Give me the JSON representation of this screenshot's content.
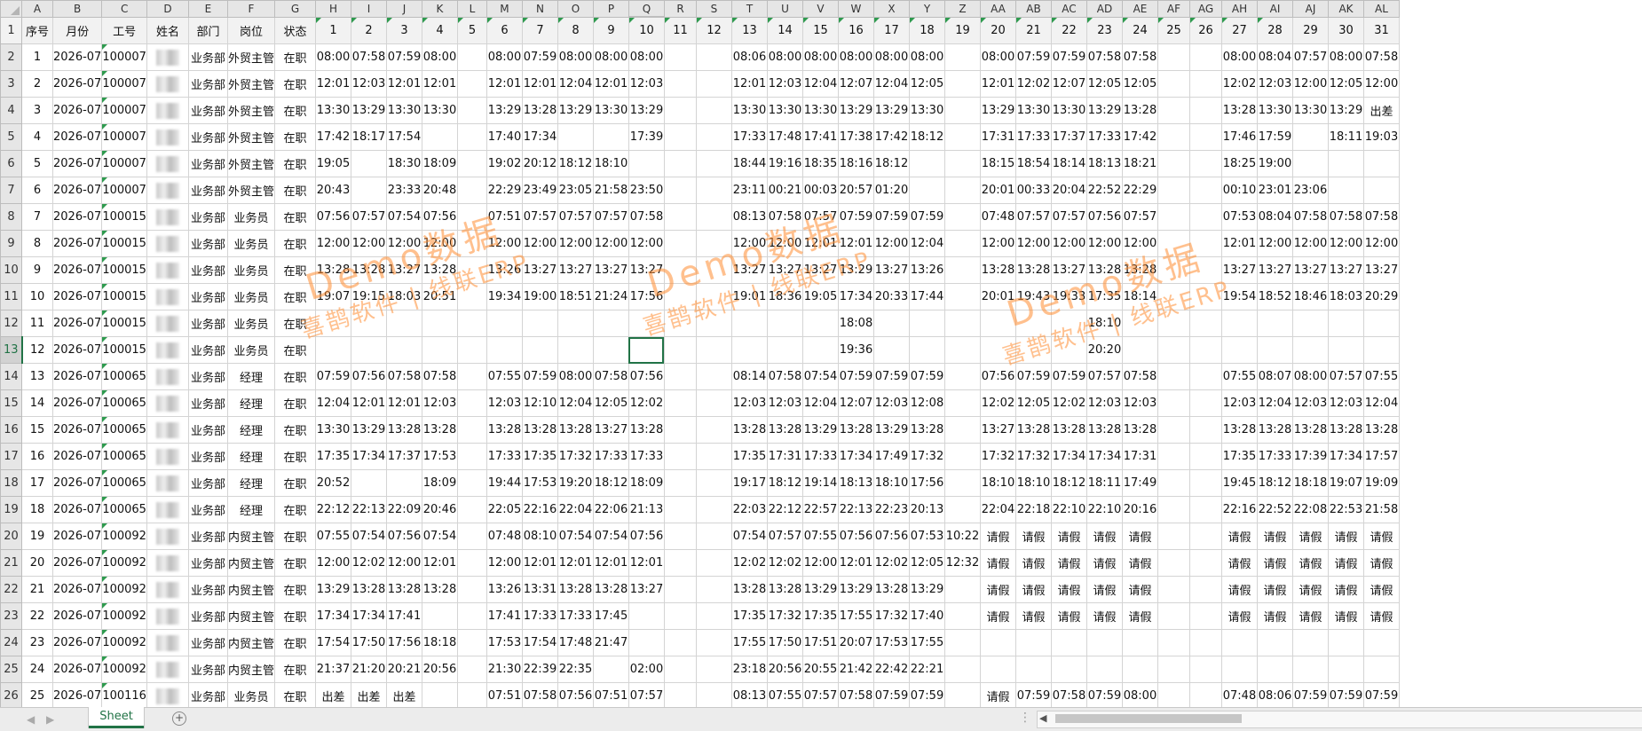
{
  "columns": [
    "A",
    "B",
    "C",
    "D",
    "E",
    "F",
    "G",
    "H",
    "I",
    "J",
    "K",
    "L",
    "M",
    "N",
    "O",
    "P",
    "Q",
    "R",
    "S",
    "T",
    "U",
    "V",
    "W",
    "X",
    "Y",
    "Z",
    "AA",
    "AB",
    "AC",
    "AD",
    "AE",
    "AF",
    "AG",
    "AH",
    "AI",
    "AJ",
    "AK",
    "AL"
  ],
  "selected_column": "Q",
  "selected_row": "13",
  "row_numbers": [
    "1",
    "2",
    "3",
    "4",
    "5",
    "6",
    "7",
    "8",
    "9",
    "10",
    "11",
    "12",
    "13",
    "14",
    "15",
    "16",
    "17",
    "18",
    "19",
    "20",
    "21",
    "22",
    "23",
    "24",
    "25",
    "26"
  ],
  "header_row": [
    "序号",
    "月份",
    "工号",
    "姓名",
    "部门",
    "岗位",
    "状态",
    "1",
    "2",
    "3",
    "4",
    "5",
    "6",
    "7",
    "8",
    "9",
    "10",
    "11",
    "12",
    "13",
    "14",
    "15",
    "16",
    "17",
    "18",
    "19",
    "20",
    "21",
    "22",
    "23",
    "24",
    "25",
    "26",
    "27",
    "28",
    "29",
    "30",
    "31"
  ],
  "rows": [
    [
      "1",
      "2026-07",
      "100007",
      "",
      "业务部",
      "外贸主管",
      "在职",
      "08:00",
      "07:58",
      "07:59",
      "08:00",
      "",
      "08:00",
      "07:59",
      "08:00",
      "08:00",
      "08:00",
      "",
      "",
      "08:06",
      "08:00",
      "08:00",
      "08:00",
      "08:00",
      "08:00",
      "",
      "08:00",
      "07:59",
      "07:59",
      "07:58",
      "07:58",
      "",
      "",
      "08:00",
      "08:04",
      "07:57",
      "08:00",
      "07:58"
    ],
    [
      "2",
      "2026-07",
      "100007",
      "",
      "业务部",
      "外贸主管",
      "在职",
      "12:01",
      "12:03",
      "12:01",
      "12:01",
      "",
      "12:01",
      "12:01",
      "12:04",
      "12:01",
      "12:03",
      "",
      "",
      "12:01",
      "12:03",
      "12:04",
      "12:07",
      "12:04",
      "12:05",
      "",
      "12:01",
      "12:02",
      "12:07",
      "12:05",
      "12:05",
      "",
      "",
      "12:02",
      "12:03",
      "12:00",
      "12:05",
      "12:00"
    ],
    [
      "3",
      "2026-07",
      "100007",
      "",
      "业务部",
      "外贸主管",
      "在职",
      "13:30",
      "13:29",
      "13:30",
      "13:30",
      "",
      "13:29",
      "13:28",
      "13:29",
      "13:30",
      "13:29",
      "",
      "",
      "13:30",
      "13:30",
      "13:30",
      "13:29",
      "13:29",
      "13:30",
      "",
      "13:29",
      "13:30",
      "13:30",
      "13:29",
      "13:28",
      "",
      "",
      "13:28",
      "13:30",
      "13:30",
      "13:29",
      "出差"
    ],
    [
      "4",
      "2026-07",
      "100007",
      "",
      "业务部",
      "外贸主管",
      "在职",
      "17:42",
      "18:17",
      "17:54",
      "",
      "",
      "17:40",
      "17:34",
      "",
      "",
      "17:39",
      "",
      "",
      "17:33",
      "17:48",
      "17:41",
      "17:38",
      "17:42",
      "18:12",
      "",
      "17:31",
      "17:33",
      "17:37",
      "17:33",
      "17:42",
      "",
      "",
      "17:46",
      "17:59",
      "",
      "18:11",
      "19:03"
    ],
    [
      "5",
      "2026-07",
      "100007",
      "",
      "业务部",
      "外贸主管",
      "在职",
      "19:05",
      "",
      "18:30",
      "18:09",
      "",
      "19:02",
      "20:12",
      "18:12",
      "18:10",
      "",
      "",
      "",
      "18:44",
      "19:16",
      "18:35",
      "18:16",
      "18:12",
      "",
      "",
      "18:15",
      "18:54",
      "18:14",
      "18:13",
      "18:21",
      "",
      "",
      "18:25",
      "19:00",
      "",
      "",
      ""
    ],
    [
      "6",
      "2026-07",
      "100007",
      "",
      "业务部",
      "外贸主管",
      "在职",
      "20:43",
      "",
      "23:33",
      "20:48",
      "",
      "22:29",
      "23:49",
      "23:05",
      "21:58",
      "23:50",
      "",
      "",
      "23:11",
      "00:21",
      "00:03",
      "20:57",
      "01:20",
      "",
      "",
      "20:01",
      "00:33",
      "20:04",
      "22:52",
      "22:29",
      "",
      "",
      "00:10",
      "23:01",
      "23:06",
      "",
      ""
    ],
    [
      "7",
      "2026-07",
      "100015",
      "",
      "业务部",
      "业务员",
      "在职",
      "07:56",
      "07:57",
      "07:54",
      "07:56",
      "",
      "07:51",
      "07:57",
      "07:57",
      "07:57",
      "07:58",
      "",
      "",
      "08:13",
      "07:58",
      "07:57",
      "07:59",
      "07:59",
      "07:59",
      "",
      "07:48",
      "07:57",
      "07:57",
      "07:56",
      "07:57",
      "",
      "",
      "07:53",
      "08:04",
      "07:58",
      "07:58",
      "07:58"
    ],
    [
      "8",
      "2026-07",
      "100015",
      "",
      "业务部",
      "业务员",
      "在职",
      "12:00",
      "12:00",
      "12:00",
      "12:00",
      "",
      "12:00",
      "12:00",
      "12:00",
      "12:00",
      "12:00",
      "",
      "",
      "12:00",
      "12:00",
      "12:01",
      "12:01",
      "12:00",
      "12:04",
      "",
      "12:00",
      "12:00",
      "12:00",
      "12:00",
      "12:00",
      "",
      "",
      "12:01",
      "12:00",
      "12:00",
      "12:00",
      "12:00"
    ],
    [
      "9",
      "2026-07",
      "100015",
      "",
      "业务部",
      "业务员",
      "在职",
      "13:28",
      "13:28",
      "13:27",
      "13:28",
      "",
      "13:26",
      "13:27",
      "13:27",
      "13:27",
      "13:27",
      "",
      "",
      "13:27",
      "13:27",
      "13:27",
      "13:29",
      "13:27",
      "13:26",
      "",
      "13:28",
      "13:28",
      "13:27",
      "13:28",
      "13:28",
      "",
      "",
      "13:27",
      "13:27",
      "13:27",
      "13:27",
      "13:27"
    ],
    [
      "10",
      "2026-07",
      "100015",
      "",
      "业务部",
      "业务员",
      "在职",
      "19:07",
      "19:15",
      "18:03",
      "20:51",
      "",
      "19:34",
      "19:00",
      "18:51",
      "21:24",
      "17:56",
      "",
      "",
      "19:01",
      "18:36",
      "19:05",
      "17:34",
      "20:33",
      "17:44",
      "",
      "20:01",
      "19:43",
      "19:33",
      "17:35",
      "18:14",
      "",
      "",
      "19:54",
      "18:52",
      "18:46",
      "18:03",
      "20:29"
    ],
    [
      "11",
      "2026-07",
      "100015",
      "",
      "业务部",
      "业务员",
      "在职",
      "",
      "",
      "",
      "",
      "",
      "",
      "",
      "",
      "",
      "",
      "",
      "",
      "",
      "",
      "",
      "18:08",
      "",
      "",
      "",
      "",
      "",
      "",
      "18:10",
      "",
      "",
      "",
      "",
      "",
      "",
      "",
      ""
    ],
    [
      "12",
      "2026-07",
      "100015",
      "",
      "业务部",
      "业务员",
      "在职",
      "",
      "",
      "",
      "",
      "",
      "",
      "",
      "",
      "",
      "",
      "",
      "",
      "",
      "",
      "",
      "19:36",
      "",
      "",
      "",
      "",
      "",
      "",
      "20:20",
      "",
      "",
      "",
      "",
      "",
      "",
      "",
      ""
    ],
    [
      "13",
      "2026-07",
      "100065",
      "",
      "业务部",
      "经理",
      "在职",
      "07:59",
      "07:56",
      "07:58",
      "07:58",
      "",
      "07:55",
      "07:59",
      "08:00",
      "07:58",
      "07:56",
      "",
      "",
      "08:14",
      "07:58",
      "07:54",
      "07:59",
      "07:59",
      "07:59",
      "",
      "07:56",
      "07:59",
      "07:59",
      "07:57",
      "07:58",
      "",
      "",
      "07:55",
      "08:07",
      "08:00",
      "07:57",
      "07:55"
    ],
    [
      "14",
      "2026-07",
      "100065",
      "",
      "业务部",
      "经理",
      "在职",
      "12:04",
      "12:01",
      "12:01",
      "12:03",
      "",
      "12:03",
      "12:10",
      "12:04",
      "12:05",
      "12:02",
      "",
      "",
      "12:03",
      "12:03",
      "12:04",
      "12:07",
      "12:03",
      "12:08",
      "",
      "12:02",
      "12:05",
      "12:02",
      "12:03",
      "12:03",
      "",
      "",
      "12:03",
      "12:04",
      "12:03",
      "12:03",
      "12:04"
    ],
    [
      "15",
      "2026-07",
      "100065",
      "",
      "业务部",
      "经理",
      "在职",
      "13:30",
      "13:29",
      "13:28",
      "13:28",
      "",
      "13:28",
      "13:28",
      "13:28",
      "13:27",
      "13:28",
      "",
      "",
      "13:28",
      "13:28",
      "13:29",
      "13:28",
      "13:29",
      "13:28",
      "",
      "13:27",
      "13:28",
      "13:28",
      "13:28",
      "13:28",
      "",
      "",
      "13:28",
      "13:28",
      "13:28",
      "13:28",
      "13:28"
    ],
    [
      "16",
      "2026-07",
      "100065",
      "",
      "业务部",
      "经理",
      "在职",
      "17:35",
      "17:34",
      "17:37",
      "17:53",
      "",
      "17:33",
      "17:35",
      "17:32",
      "17:33",
      "17:33",
      "",
      "",
      "17:35",
      "17:31",
      "17:33",
      "17:34",
      "17:49",
      "17:32",
      "",
      "17:32",
      "17:32",
      "17:34",
      "17:34",
      "17:31",
      "",
      "",
      "17:35",
      "17:33",
      "17:39",
      "17:34",
      "17:57"
    ],
    [
      "17",
      "2026-07",
      "100065",
      "",
      "业务部",
      "经理",
      "在职",
      "20:52",
      "",
      "",
      "18:09",
      "",
      "19:44",
      "17:53",
      "19:20",
      "18:12",
      "18:09",
      "",
      "",
      "19:17",
      "18:12",
      "19:14",
      "18:13",
      "18:10",
      "17:56",
      "",
      "18:10",
      "18:10",
      "18:12",
      "18:11",
      "17:49",
      "",
      "",
      "19:45",
      "18:12",
      "18:18",
      "19:07",
      "19:09"
    ],
    [
      "18",
      "2026-07",
      "100065",
      "",
      "业务部",
      "经理",
      "在职",
      "22:12",
      "22:13",
      "22:09",
      "20:46",
      "",
      "22:05",
      "22:16",
      "22:04",
      "22:06",
      "21:13",
      "",
      "",
      "22:03",
      "22:12",
      "22:57",
      "22:13",
      "22:23",
      "20:13",
      "",
      "22:04",
      "22:18",
      "22:10",
      "22:10",
      "20:16",
      "",
      "",
      "22:16",
      "22:52",
      "22:08",
      "22:53",
      "21:58"
    ],
    [
      "19",
      "2026-07",
      "100092",
      "",
      "业务部",
      "内贸主管",
      "在职",
      "07:55",
      "07:54",
      "07:56",
      "07:54",
      "",
      "07:48",
      "08:10",
      "07:54",
      "07:54",
      "07:56",
      "",
      "",
      "07:54",
      "07:57",
      "07:55",
      "07:56",
      "07:56",
      "07:53",
      "10:22",
      "请假",
      "请假",
      "请假",
      "请假",
      "请假",
      "",
      "",
      "请假",
      "请假",
      "请假",
      "请假",
      "请假"
    ],
    [
      "20",
      "2026-07",
      "100092",
      "",
      "业务部",
      "内贸主管",
      "在职",
      "12:00",
      "12:02",
      "12:00",
      "12:01",
      "",
      "12:00",
      "12:01",
      "12:01",
      "12:01",
      "12:01",
      "",
      "",
      "12:02",
      "12:02",
      "12:00",
      "12:01",
      "12:02",
      "12:05",
      "12:32",
      "请假",
      "请假",
      "请假",
      "请假",
      "请假",
      "",
      "",
      "请假",
      "请假",
      "请假",
      "请假",
      "请假"
    ],
    [
      "21",
      "2026-07",
      "100092",
      "",
      "业务部",
      "内贸主管",
      "在职",
      "13:29",
      "13:28",
      "13:28",
      "13:28",
      "",
      "13:26",
      "13:31",
      "13:28",
      "13:28",
      "13:27",
      "",
      "",
      "13:28",
      "13:28",
      "13:29",
      "13:29",
      "13:28",
      "13:29",
      "",
      "请假",
      "请假",
      "请假",
      "请假",
      "请假",
      "",
      "",
      "请假",
      "请假",
      "请假",
      "请假",
      "请假"
    ],
    [
      "22",
      "2026-07",
      "100092",
      "",
      "业务部",
      "内贸主管",
      "在职",
      "17:34",
      "17:34",
      "17:41",
      "",
      "",
      "17:41",
      "17:33",
      "17:33",
      "17:45",
      "",
      "",
      "",
      "17:35",
      "17:32",
      "17:35",
      "17:55",
      "17:32",
      "17:40",
      "",
      "请假",
      "请假",
      "请假",
      "请假",
      "请假",
      "",
      "",
      "请假",
      "请假",
      "请假",
      "请假",
      "请假"
    ],
    [
      "23",
      "2026-07",
      "100092",
      "",
      "业务部",
      "内贸主管",
      "在职",
      "17:54",
      "17:50",
      "17:56",
      "18:18",
      "",
      "17:53",
      "17:54",
      "17:48",
      "21:47",
      "",
      "",
      "",
      "17:55",
      "17:50",
      "17:51",
      "20:07",
      "17:53",
      "17:55",
      "",
      "",
      "",
      "",
      "",
      "",
      "",
      "",
      "",
      "",
      "",
      "",
      ""
    ],
    [
      "24",
      "2026-07",
      "100092",
      "",
      "业务部",
      "内贸主管",
      "在职",
      "21:37",
      "21:20",
      "20:21",
      "20:56",
      "",
      "21:30",
      "22:39",
      "22:35",
      "",
      "02:00",
      "",
      "",
      "23:18",
      "20:56",
      "20:55",
      "21:42",
      "22:42",
      "22:21",
      "",
      "",
      "",
      "",
      "",
      "",
      "",
      "",
      "",
      "",
      "",
      "",
      ""
    ],
    [
      "25",
      "2026-07",
      "100116",
      "",
      "业务部",
      "业务员",
      "在职",
      "出差",
      "出差",
      "出差",
      "",
      "",
      "07:51",
      "07:58",
      "07:56",
      "07:51",
      "07:57",
      "",
      "",
      "08:13",
      "07:55",
      "07:57",
      "07:58",
      "07:59",
      "07:59",
      "",
      "请假",
      "07:59",
      "07:58",
      "07:59",
      "08:00",
      "",
      "",
      "07:48",
      "08:06",
      "07:59",
      "07:59",
      "07:59"
    ]
  ],
  "watermarks": [
    {
      "line1": "Demo数据",
      "line2": "喜鹊软件 | 线联ERP"
    },
    {
      "line1": "Demo数据",
      "line2": "喜鹊软件 | 线联ERP"
    },
    {
      "line1": "Demo数据",
      "line2": "喜鹊软件 | 线联ERP"
    }
  ],
  "sheet_tab": "Sheet",
  "add_sheet_icon": "plus-circle-icon",
  "theme": {
    "accent": "#217346",
    "watermark": "#ff8c32"
  }
}
